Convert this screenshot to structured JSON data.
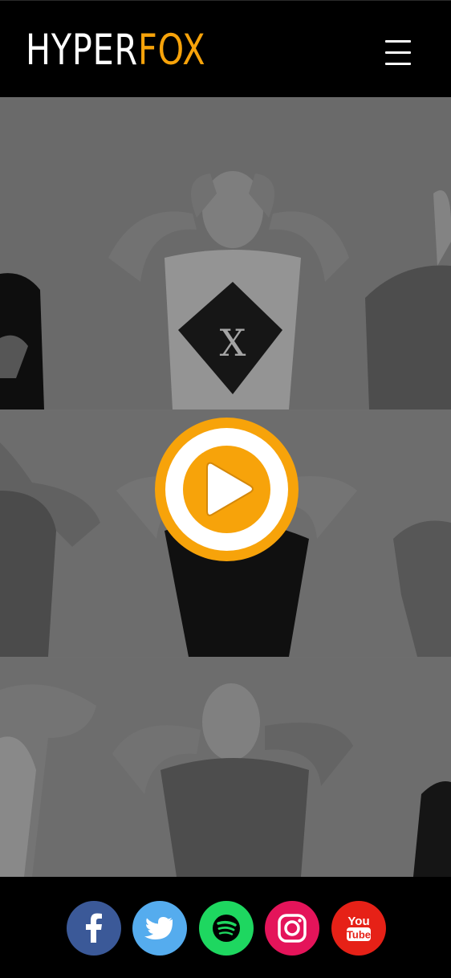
{
  "header": {
    "logo_part1": "HYPER",
    "logo_part2": "FOX",
    "logo_colors": {
      "primary": "#ffffff",
      "accent": "#f7a30a"
    },
    "menu_icon": "hamburger-menu-icon"
  },
  "hero": {
    "photos": [
      "band-member-photo-row-1",
      "band-member-photo-row-2",
      "band-member-photo-row-3"
    ],
    "play_icon": "play-icon",
    "play_color": "#f7a30a"
  },
  "footer": {
    "social_links": [
      {
        "icon": "facebook-icon",
        "color": "#3b5998"
      },
      {
        "icon": "twitter-icon",
        "color": "#55acee"
      },
      {
        "icon": "spotify-icon",
        "color": "#1ed760"
      },
      {
        "icon": "instagram-icon",
        "color": "#e4145a"
      },
      {
        "icon": "youtube-icon",
        "color": "#e62117",
        "label_top": "You",
        "label_bottom": "Tube"
      }
    ]
  }
}
